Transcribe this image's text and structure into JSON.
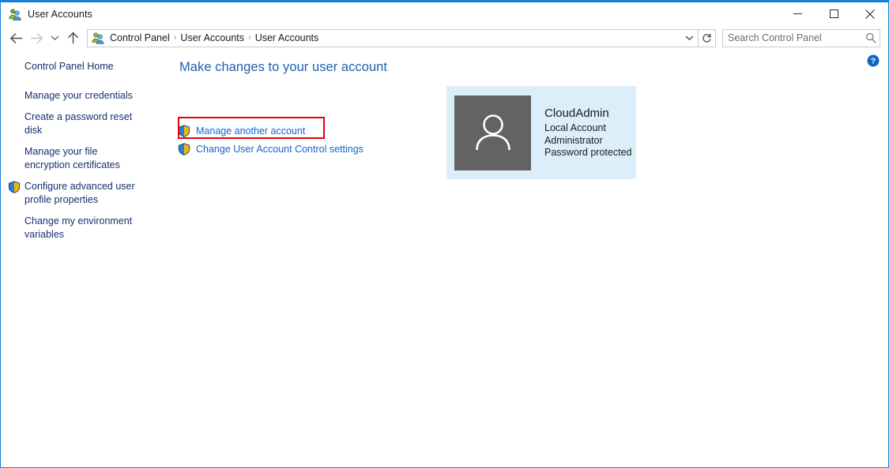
{
  "window": {
    "title": "User Accounts",
    "icon": "user-accounts-icon",
    "border_color": "#1581d6",
    "controls": {
      "minimize": "Minimize",
      "maximize": "Maximize",
      "close": "Close"
    }
  },
  "toolbar": {
    "back": "Back",
    "forward": "Forward",
    "recent_locations": "Recent locations",
    "up": "Up one level",
    "breadcrumb": [
      "Control Panel",
      "User Accounts",
      "User Accounts"
    ],
    "breadcrumb_separator": "›",
    "address_dropdown": "Previous locations",
    "refresh": "Refresh",
    "search": {
      "placeholder": "Search Control Panel",
      "value": "",
      "icon": "search-icon"
    }
  },
  "help": {
    "label": "Help",
    "icon": "help-icon",
    "color": "#1464c8"
  },
  "sidebar": {
    "items": [
      {
        "label": "Control Panel Home",
        "shield": false
      },
      {
        "label": "Manage your credentials",
        "shield": false
      },
      {
        "label": "Create a password reset disk",
        "shield": false
      },
      {
        "label": "Manage your file encryption certificates",
        "shield": false
      },
      {
        "label": "Configure advanced user profile properties",
        "shield": true
      },
      {
        "label": "Change my environment variables",
        "shield": false
      }
    ],
    "link_color": "#16316d"
  },
  "main": {
    "heading": "Make changes to your user account",
    "heading_color": "#1f5fad",
    "link_color": "#1464c8",
    "tasks": [
      {
        "label": "Manage another account",
        "shield": true,
        "highlighted": true
      },
      {
        "label": "Change User Account Control settings",
        "shield": true,
        "highlighted": false
      }
    ],
    "highlight_color": "#e60000"
  },
  "account_card": {
    "background": "#ddeefb",
    "avatar_background": "#636363",
    "avatar_icon": "user-avatar-icon",
    "name": "CloudAdmin",
    "details": [
      "Local Account",
      "Administrator",
      "Password protected"
    ]
  }
}
